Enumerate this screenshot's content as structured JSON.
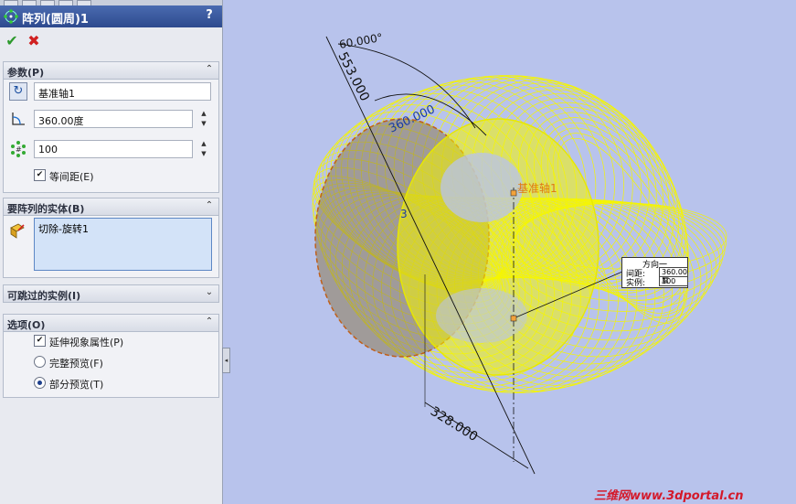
{
  "panel": {
    "title": "阵列(圆周)1",
    "help_label": "?",
    "ok_glyph": "✔",
    "cancel_glyph": "✖"
  },
  "params": {
    "header": "参数(P)",
    "axis_value": "基准轴1",
    "angle_value": "360.00度",
    "count_value": "100",
    "equal_spacing_label": "等间距(E)",
    "equal_spacing_checked": true
  },
  "bodies": {
    "header": "要阵列的实体(B)",
    "items": [
      "切除-旋转1"
    ]
  },
  "skip": {
    "header": "可跳过的实例(I)"
  },
  "options": {
    "header": "选项(O)",
    "propagate_label": "延伸视象属性(P)",
    "propagate_checked": true,
    "full_preview_label": "完整预览(F)",
    "partial_preview_label": "部分预览(T)",
    "selected_preview": "partial"
  },
  "viewport": {
    "dim_angle": "60.000°",
    "dim_553": "553.000",
    "dim_360": "360.000",
    "dim_328": "328.000",
    "dim_small": "3",
    "axis_label": "基准轴1",
    "callout": {
      "title": "方向一",
      "spacing_label": "间距:",
      "spacing_value": "360.00度",
      "count_label": "实例:",
      "count_value": "100"
    }
  },
  "watermark": "三维网www.3dportal.cn",
  "colors": {
    "wire": "#f5f500",
    "background": "#b8c3ec",
    "titlebar": "#2d4a8e"
  }
}
